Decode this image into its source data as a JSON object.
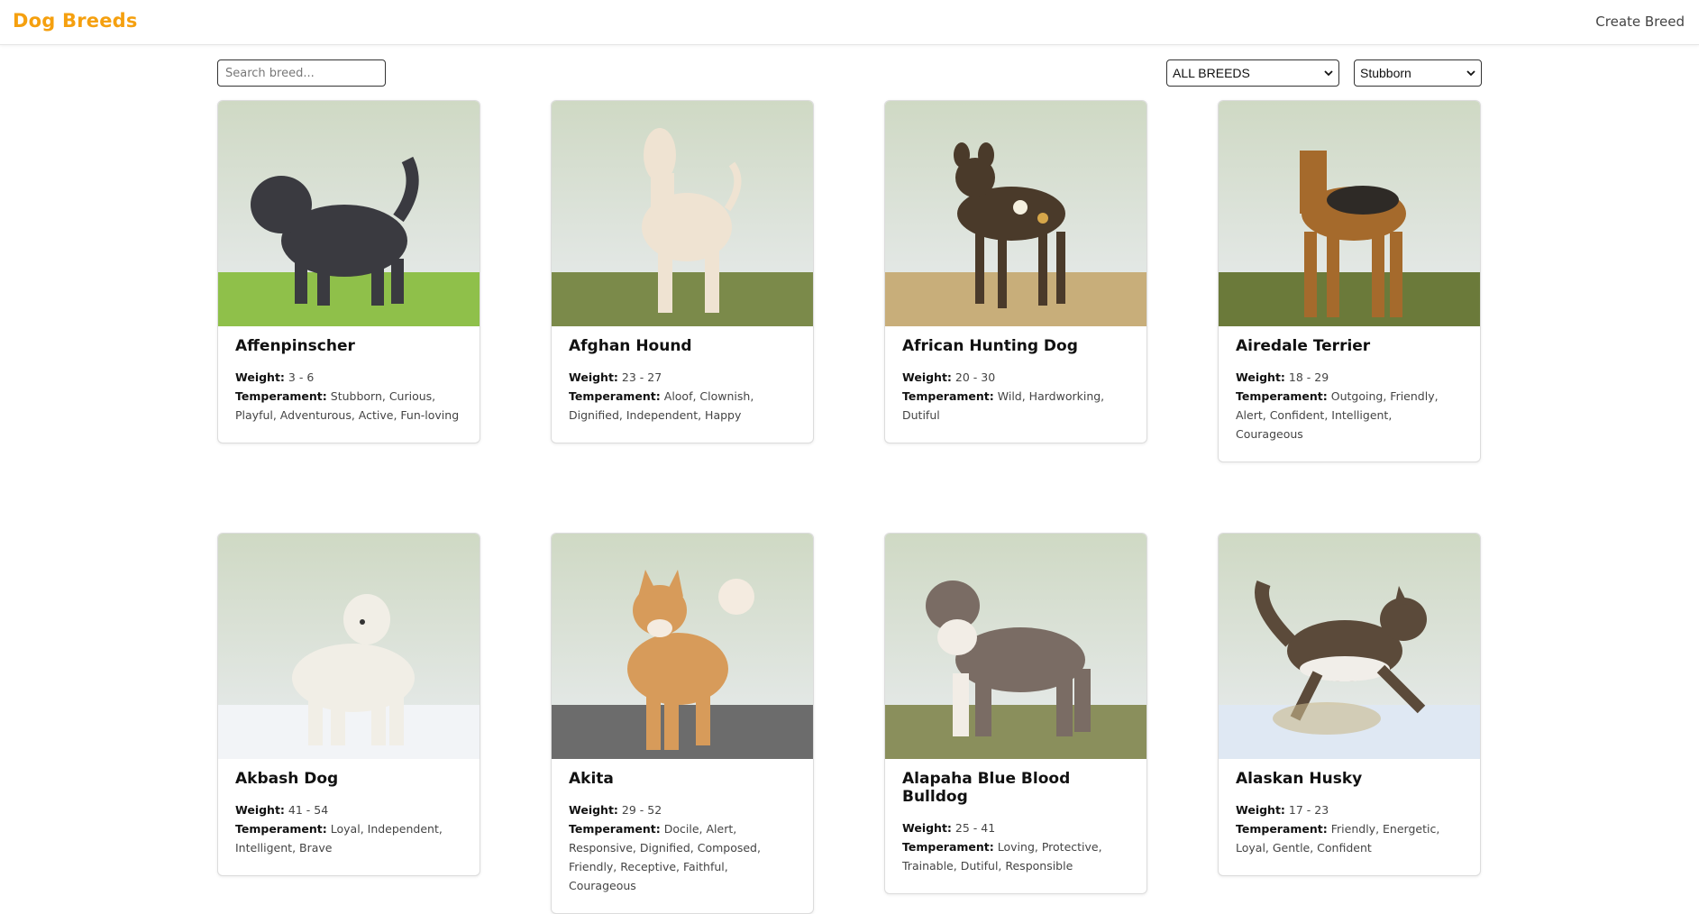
{
  "header": {
    "brand": "Dog Breeds",
    "create_link": "Create Breed"
  },
  "controls": {
    "search_placeholder": "Search breed...",
    "source_filter": "ALL BREEDS",
    "temperament_filter": "Stubborn"
  },
  "labels": {
    "weight": "Weight:",
    "temperament": "Temperament:"
  },
  "breeds": [
    {
      "name": "Affenpinscher",
      "weight": "3 - 6",
      "temperament": "Stubborn, Curious, Playful, Adventurous, Active, Fun-loving"
    },
    {
      "name": "Afghan Hound",
      "weight": "23 - 27",
      "temperament": "Aloof, Clownish, Dignified, Independent, Happy"
    },
    {
      "name": "African Hunting Dog",
      "weight": "20 - 30",
      "temperament": "Wild, Hardworking, Dutiful"
    },
    {
      "name": "Airedale Terrier",
      "weight": "18 - 29",
      "temperament": "Outgoing, Friendly, Alert, Confident, Intelligent, Courageous"
    },
    {
      "name": "Akbash Dog",
      "weight": "41 - 54",
      "temperament": "Loyal, Independent, Intelligent, Brave"
    },
    {
      "name": "Akita",
      "weight": "29 - 52",
      "temperament": "Docile, Alert, Responsive, Dignified, Composed, Friendly, Receptive, Faithful, Courageous"
    },
    {
      "name": "Alapaha Blue Blood Bulldog",
      "weight": "25 - 41",
      "temperament": "Loving, Protective, Trainable, Dutiful, Responsible"
    },
    {
      "name": "Alaskan Husky",
      "weight": "17 - 23",
      "temperament": "Friendly, Energetic, Loyal, Gentle, Confident"
    }
  ],
  "colors": {
    "brand": "#f5a00f"
  }
}
